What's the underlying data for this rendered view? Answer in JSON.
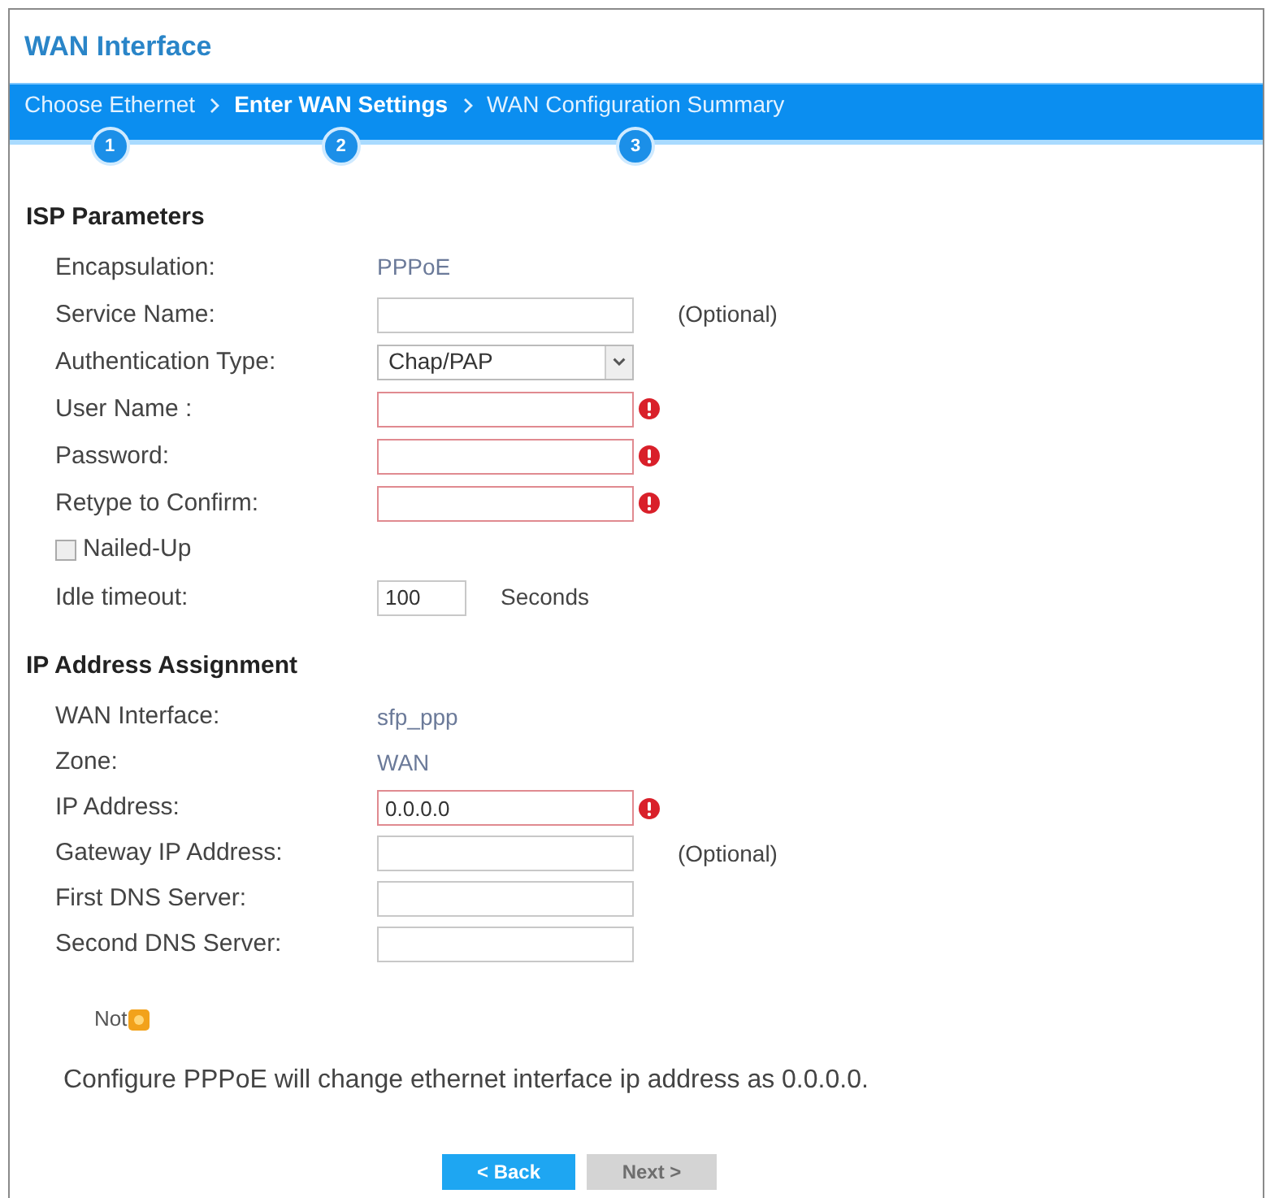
{
  "window": {
    "title": "WAN Interface"
  },
  "wizard": {
    "steps": [
      {
        "label": "Choose Ethernet",
        "number": "1",
        "selected": false
      },
      {
        "label": "Enter WAN Settings",
        "number": "2",
        "selected": true
      },
      {
        "label": "WAN Configuration Summary",
        "number": "3",
        "selected": false
      }
    ]
  },
  "sections": [
    {
      "title": "ISP Parameters",
      "fields": [
        {
          "kind": "value",
          "label": "Encapsulation:",
          "value": "PPPoE"
        },
        {
          "kind": "input",
          "label": "Service Name:",
          "required": false,
          "note": "(Optional)"
        },
        {
          "kind": "select",
          "label": "Authentication Type:",
          "value": "Chap/PAP"
        },
        {
          "kind": "input",
          "label": "User Name :",
          "required": true
        },
        {
          "kind": "input",
          "label": "Password:",
          "required": true
        },
        {
          "kind": "input",
          "label": "Retype to Confirm:",
          "required": true
        },
        {
          "kind": "checkbox",
          "label": "Nailed-Up",
          "checked": false
        },
        {
          "kind": "number",
          "label": "Idle timeout:",
          "value": "100",
          "unit": "Seconds",
          "required": false
        }
      ]
    },
    {
      "title": "IP Address Assignment",
      "fields": [
        {
          "kind": "value",
          "label": "WAN Interface:",
          "value": "sfp_ppp"
        },
        {
          "kind": "value",
          "label": "Zone:",
          "value": "WAN"
        },
        {
          "kind": "input",
          "label": "IP Address:",
          "value": "0.0.0.0",
          "required": true
        },
        {
          "kind": "input",
          "label": "Gateway IP Address:",
          "required": false,
          "note": "(Optional)"
        },
        {
          "kind": "input",
          "label": "First DNS Server:",
          "required": false
        },
        {
          "kind": "input",
          "label": "Second DNS Server:",
          "required": false
        }
      ]
    }
  ],
  "note": {
    "label": "Not",
    "text": "Configure PPPoE will change ethernet interface ip address as 0.0.0.0."
  },
  "buttons": [
    {
      "label": "< Back",
      "disabled": false
    },
    {
      "label": "Next >",
      "disabled": true
    }
  ]
}
